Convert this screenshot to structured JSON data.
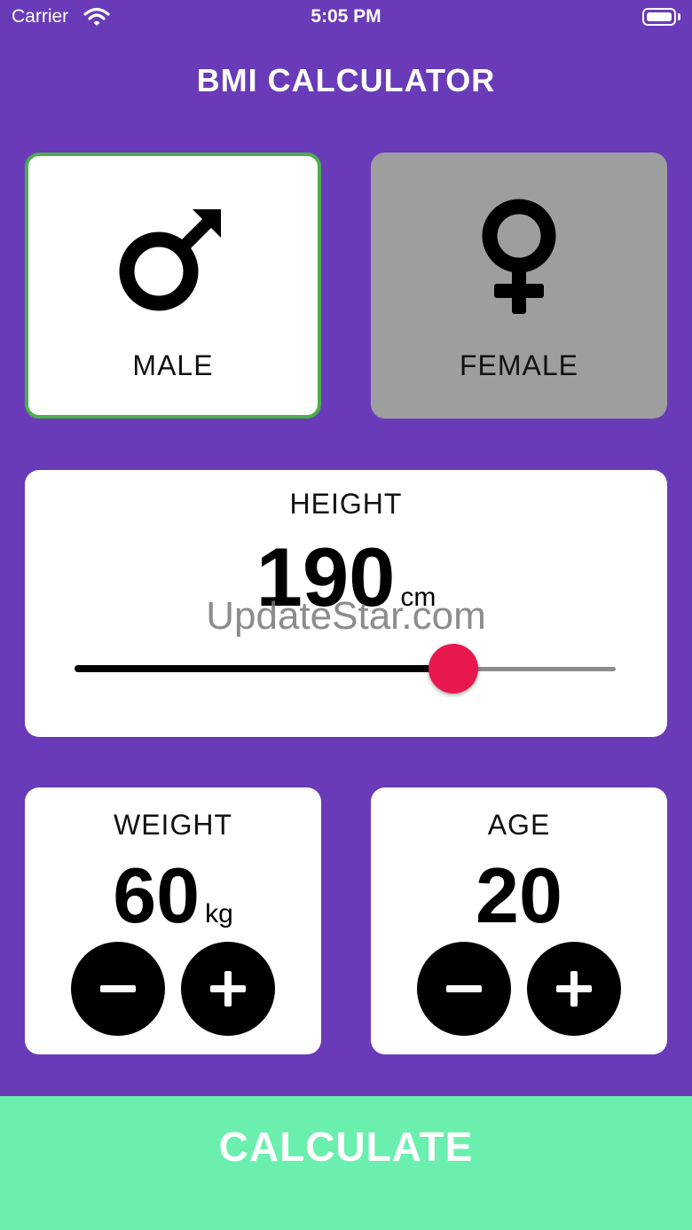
{
  "status_bar": {
    "carrier": "Carrier",
    "time": "5:05 PM"
  },
  "app": {
    "title": "BMI CALCULATOR"
  },
  "gender": {
    "male_label": "MALE",
    "female_label": "FEMALE",
    "selected": "male"
  },
  "height": {
    "label": "HEIGHT",
    "value": "190",
    "unit": "cm",
    "slider_fraction": 0.7
  },
  "watermark": "UpdateStar.com",
  "weight": {
    "label": "WEIGHT",
    "value": "60",
    "unit": "kg"
  },
  "age": {
    "label": "AGE",
    "value": "20"
  },
  "calculate_label": "CALCULATE",
  "colors": {
    "background": "#6a3bb8",
    "card": "#ffffff",
    "selected_border": "#4cae4c",
    "unselected_card": "#9e9e9e",
    "slider_thumb": "#e8184f",
    "calculate_button": "#6aefae"
  }
}
